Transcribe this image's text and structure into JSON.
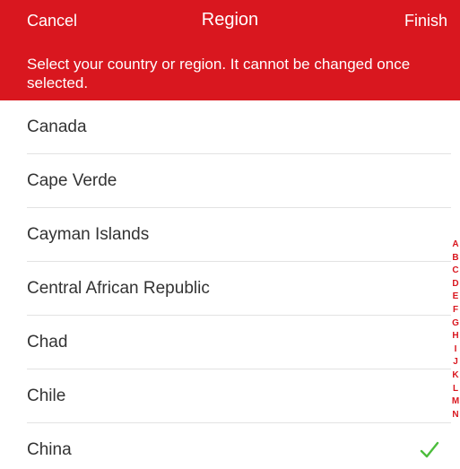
{
  "header": {
    "cancel": "Cancel",
    "title": "Region",
    "finish": "Finish"
  },
  "notice": "Select your country or region. It cannot be changed once selected.",
  "countries": [
    "Canada",
    "Cape Verde",
    "Cayman Islands",
    "Central African Republic",
    "Chad",
    "Chile",
    "China"
  ],
  "selected": "China",
  "index_letters": [
    "A",
    "B",
    "C",
    "D",
    "E",
    "F",
    "G",
    "H",
    "I",
    "J",
    "K",
    "L",
    "M",
    "N"
  ],
  "colors": {
    "accent": "#d9171f",
    "check": "#4cbd3c"
  },
  "icons": {
    "selected_marker": "checkmark-icon"
  }
}
